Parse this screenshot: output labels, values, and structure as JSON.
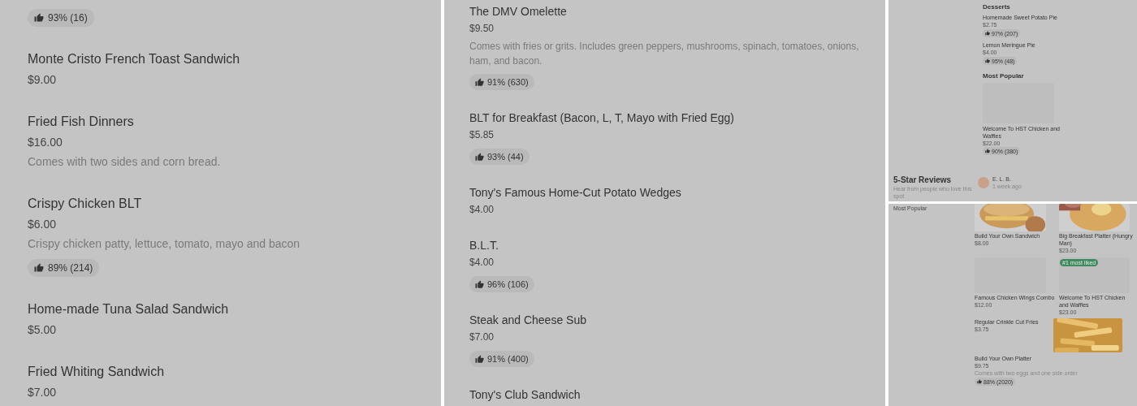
{
  "left_panel": {
    "items": [
      {
        "rating": "93% (16)"
      },
      {
        "name": "Monte Cristo French Toast Sandwich",
        "price": "$9.00"
      },
      {
        "name": "Fried Fish Dinners",
        "price": "$16.00",
        "description": "Comes with two sides and corn bread."
      },
      {
        "name": "Crispy Chicken BLT",
        "price": "$6.00",
        "description": "Crispy chicken patty, lettuce, tomato, mayo and bacon",
        "rating": "89% (214)"
      },
      {
        "name": "Home-made Tuna Salad Sandwich",
        "price": "$5.00"
      },
      {
        "name": "Fried Whiting Sandwich",
        "price": "$7.00"
      }
    ]
  },
  "middle_panel": {
    "items": [
      {
        "name": "The DMV Omelette",
        "price": "$9.50",
        "description": "Comes with fries or grits. Includes green peppers, mushrooms, spinach, tomatoes, onions, ham, and bacon.",
        "rating": "91% (630)"
      },
      {
        "name": "BLT for Breakfast (Bacon, L, T, Mayo with Fried Egg)",
        "price": "$5.85",
        "rating": "93% (44)"
      },
      {
        "name": "Tony's Famous Home-Cut Potato Wedges",
        "price": "$4.00"
      },
      {
        "name": "B.L.T.",
        "price": "$4.00",
        "rating": "96% (106)"
      },
      {
        "name": "Steak and Cheese Sub",
        "price": "$7.00",
        "rating": "91% (400)"
      },
      {
        "name": "Tony's Club Sandwich"
      }
    ]
  },
  "right_top": {
    "desserts": {
      "title": "Desserts",
      "items": [
        {
          "name": "Homemade Sweet Potato Pie",
          "price": "$2.75",
          "rating": "97% (207)"
        },
        {
          "name": "Lemon Meringue Pie",
          "price": "$4.00",
          "rating": "95% (48)"
        }
      ]
    },
    "most_popular": {
      "title": "Most Popular",
      "items": [
        {
          "name": "Welcome To HST Chicken and Waffles",
          "price": "$22.00",
          "rating": "90% (380)",
          "kind": "placeholder"
        }
      ]
    },
    "reviews": {
      "title": "5-Star Reviews",
      "subtitle": "Hear from people who love this spot",
      "reviewer": {
        "name": "E. L. B.",
        "time": "1 week ago"
      }
    }
  },
  "right_bottom": {
    "sidebar_label": "Most Popular",
    "card_rows": [
      {
        "cards": [
          {
            "name": "Build Your Own Sandwich",
            "price": "$8.00",
            "kind": "picture"
          },
          {
            "name": "Big Breakfast Platter (Hungry Man)",
            "price": "$23.00",
            "kind": "picture"
          }
        ]
      },
      {
        "cards": [
          {
            "name": "Famous Chicken Wings Combo",
            "price": "$12.00",
            "kind": "placeholder"
          },
          {
            "name": "Welcome To HST Chicken and Waffles",
            "price": "$23.00",
            "kind": "placeholder",
            "badge": "#1 most liked"
          }
        ]
      }
    ],
    "items": [
      {
        "name": "Regular Crinkle Cut Fries",
        "price": "$3.75",
        "kind": "picture"
      },
      {
        "name": "Build Your Own Platter",
        "price": "$9.75",
        "description": "Comes with two eggs and one side order",
        "rating": "88% (2020)"
      }
    ]
  }
}
